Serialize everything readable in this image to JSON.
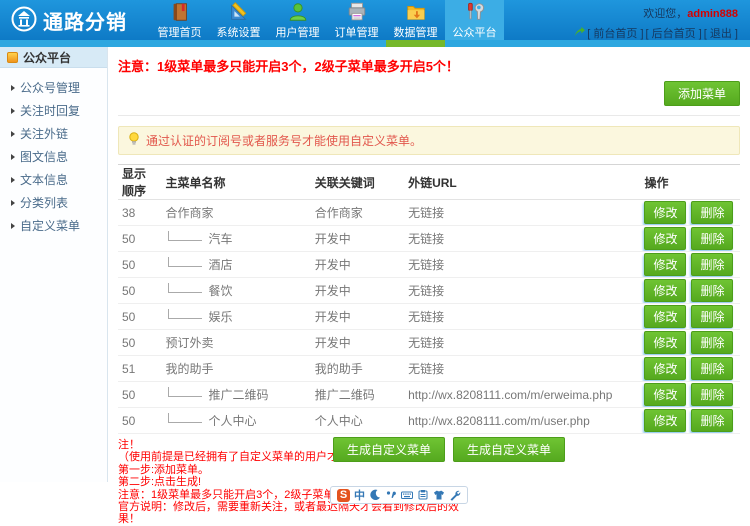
{
  "header": {
    "logo_text": "通路分销",
    "welcome_prefix": "欢迎您，",
    "username": "admin888",
    "links": [
      "[ 前台首页 ]",
      "[ 后台首页 ]",
      "[ 退出 ]"
    ],
    "nav": [
      {
        "label": "管理首页",
        "icon": "book-icon"
      },
      {
        "label": "系统设置",
        "icon": "set-square-icon"
      },
      {
        "label": "用户管理",
        "icon": "user-icon"
      },
      {
        "label": "订单管理",
        "icon": "printer-icon"
      },
      {
        "label": "数据管理",
        "icon": "folder-icon"
      },
      {
        "label": "公众平台",
        "icon": "tools-icon",
        "active": true
      }
    ]
  },
  "sidebar": {
    "title": "公众平台",
    "items": [
      "公众号管理",
      "关注时回复",
      "关注外链",
      "图文信息",
      "文本信息",
      "分类列表",
      "自定义菜单"
    ]
  },
  "main": {
    "warning": "注意：1级菜单最多只能开启3个，2级子菜单最多开启5个！",
    "add_button": "添加菜单",
    "tip": "通过认证的订阅号或者服务号才能使用自定义菜单。",
    "table": {
      "headers": [
        "显示顺序",
        "主菜单名称",
        "关联关键词",
        "外链URL",
        "操作"
      ],
      "modify_label": "修改",
      "delete_label": "删除",
      "rows": [
        {
          "order": "38",
          "name": "合作商家",
          "sub": false,
          "keyword": "合作商家",
          "url": "无链接"
        },
        {
          "order": "50",
          "name": "汽车",
          "sub": true,
          "keyword": "开发中",
          "url": "无链接"
        },
        {
          "order": "50",
          "name": "酒店",
          "sub": true,
          "keyword": "开发中",
          "url": "无链接"
        },
        {
          "order": "50",
          "name": "餐饮",
          "sub": true,
          "keyword": "开发中",
          "url": "无链接"
        },
        {
          "order": "50",
          "name": "娱乐",
          "sub": true,
          "keyword": "开发中",
          "url": "无链接"
        },
        {
          "order": "50",
          "name": "预订外卖",
          "sub": false,
          "keyword": "开发中",
          "url": "无链接"
        },
        {
          "order": "51",
          "name": "我的助手",
          "sub": false,
          "keyword": "我的助手",
          "url": "无链接"
        },
        {
          "order": "50",
          "name": "推广二维码",
          "sub": true,
          "keyword": "推广二维码",
          "url": "http://wx.8208111.com/m/erweima.php"
        },
        {
          "order": "50",
          "name": "个人中心",
          "sub": true,
          "keyword": "个人中心",
          "url": "http://wx.8208111.com/m/user.php"
        }
      ]
    },
    "notes": [
      "注！",
      "（使用前提是已经拥有了自定义菜单的用户才能够使用。）",
      "第一步:添加菜单。",
      "第二步:点击生成!",
      "注意：1级菜单最多只能开启3个，2级子菜单最多开启5个",
      "官方说明：修改后，需要重新关注，或者最迟隔天才会看到修改后的效果！"
    ],
    "generate_buttons": [
      "生成自定义菜单",
      "生成自定义菜单"
    ]
  },
  "ime_bar": {
    "logo": "S",
    "mode_label": "中"
  },
  "colors": {
    "header_blue": "#1f96dd",
    "header_blue_dark": "#0e7ac6",
    "active_tab_blue": "#3cade5",
    "strip_blue": "#2ea7e0",
    "active_underline_green": "#76b82a",
    "button_green": "#5cb324",
    "warning_red": "#ff0000",
    "tip_bg": "#fbf7de",
    "tip_text": "#e2574c",
    "username_red": "#d40000"
  }
}
